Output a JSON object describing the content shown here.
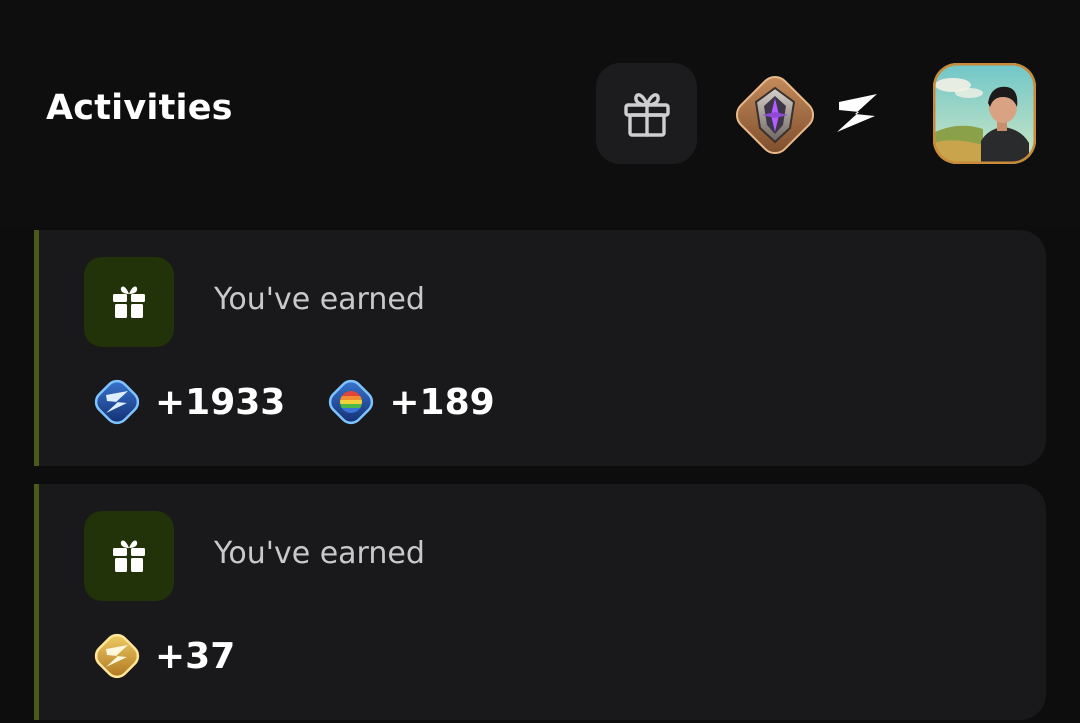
{
  "header": {
    "title": "Activities"
  },
  "activities": [
    {
      "label": "You've earned",
      "rewards": [
        {
          "icon": "blue-bolt-coin-icon",
          "amount": "+1933"
        },
        {
          "icon": "rainbow-gem-coin-icon",
          "amount": "+189"
        }
      ]
    },
    {
      "label": "You've earned",
      "rewards": [
        {
          "icon": "gold-bolt-coin-icon",
          "amount": "+37"
        }
      ]
    }
  ],
  "colors": {
    "background": "#0d0d0e",
    "card": "#19191b",
    "accent_border": "#4a5a1b",
    "icon_tile": "#223209",
    "avatar_border": "#c98a3a"
  }
}
